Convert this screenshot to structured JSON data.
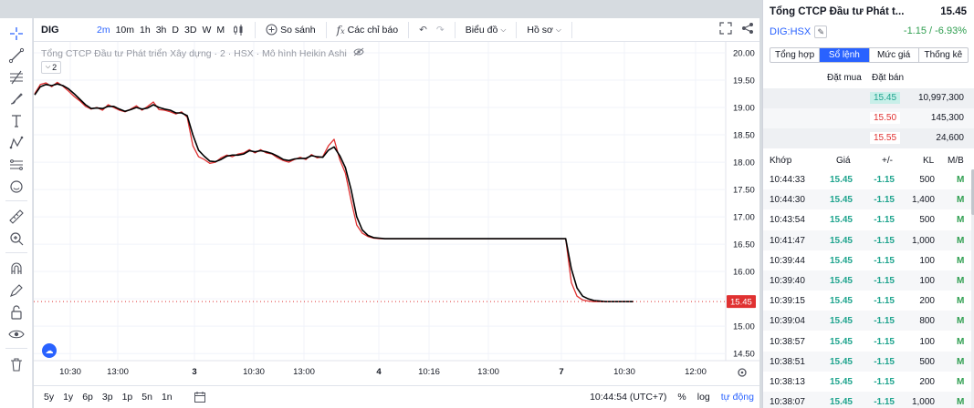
{
  "chart": {
    "symbol": "DIG",
    "intervals": [
      {
        "label": "2m",
        "active": true
      },
      {
        "label": "10m",
        "active": false
      },
      {
        "label": "1h",
        "active": false
      },
      {
        "label": "3h",
        "active": false
      },
      {
        "label": "D",
        "active": false
      },
      {
        "label": "3D",
        "active": false
      },
      {
        "label": "W",
        "active": false
      },
      {
        "label": "M",
        "active": false
      }
    ],
    "compare_label": "So sánh",
    "indicators_label": "Các chỉ báo",
    "chart_type_label": "Biểu đồ",
    "profile_label": "Hồ sơ",
    "legend_text": "Tổng CTCP Đầu tư Phát triển Xây dựng · 2 · HSX · Mô hình Heikin Ashi",
    "legend_toggle": "2",
    "time_ranges": [
      "5y",
      "1y",
      "6p",
      "3p",
      "1p",
      "5n",
      "1n"
    ],
    "clock": "10:44:54 (UTC+7)",
    "percent_label": "%",
    "log_label": "log",
    "auto_label": "tự động",
    "last_price_tag": "15.45",
    "accent": "#2962ff"
  },
  "chart_data": {
    "type": "line",
    "y_ticks": [
      "20.00",
      "19.50",
      "19.00",
      "18.50",
      "18.00",
      "17.50",
      "17.00",
      "16.50",
      "16.00",
      "15.50",
      "15.00",
      "14.50"
    ],
    "ylim": [
      14.5,
      20.0
    ],
    "x_ticks": [
      "10:30",
      "13:00",
      "3",
      "10:30",
      "13:00",
      "4",
      "10:16",
      "13:00",
      "7",
      "10:30",
      "12:00"
    ],
    "series": [
      {
        "color": "#000000",
        "values": [
          19.23,
          19.38,
          19.42,
          19.4,
          19.43,
          19.4,
          19.34,
          19.25,
          19.15,
          19.05,
          18.98,
          18.99,
          18.98,
          19.02,
          19.02,
          18.97,
          18.93,
          18.96,
          19.0,
          18.97,
          18.99,
          19.05,
          19.0,
          18.97,
          18.95,
          18.9,
          18.9,
          18.85,
          18.5,
          18.22,
          18.11,
          18.02,
          18.01,
          18.05,
          18.11,
          18.13,
          18.13,
          18.15,
          18.21,
          18.19,
          18.21,
          18.19,
          18.16,
          18.11,
          18.05,
          18.03,
          18.06,
          18.07,
          18.07,
          18.12,
          18.1,
          18.09,
          18.22,
          18.28,
          18.12,
          17.9,
          17.5,
          17.0,
          16.76,
          16.66,
          16.62,
          16.61,
          16.6,
          16.6,
          16.6,
          16.6,
          16.6,
          16.6,
          16.6,
          16.6,
          16.6,
          16.6,
          16.6,
          16.6,
          16.6,
          16.6,
          16.6,
          16.6,
          16.6,
          16.6,
          16.6,
          16.6,
          16.6,
          16.6,
          16.6,
          16.6,
          16.6,
          16.6,
          16.6,
          16.6,
          16.6,
          16.6,
          16.6,
          16.6,
          16.6,
          16.05,
          15.7,
          15.55,
          15.5,
          15.47,
          15.46,
          15.45,
          15.45,
          15.45,
          15.45,
          15.45,
          15.45
        ]
      },
      {
        "color": "#e03131",
        "values": [
          19.25,
          19.42,
          19.45,
          19.38,
          19.46,
          19.39,
          19.3,
          19.2,
          19.12,
          19.02,
          18.97,
          19.0,
          18.95,
          19.05,
          19.0,
          18.95,
          18.92,
          18.97,
          19.03,
          18.95,
          19.02,
          19.1,
          18.96,
          18.95,
          18.92,
          18.88,
          18.92,
          18.82,
          18.3,
          18.1,
          18.05,
          17.98,
          18.0,
          18.08,
          18.13,
          18.1,
          18.15,
          18.17,
          18.23,
          18.17,
          18.23,
          18.17,
          18.15,
          18.08,
          18.03,
          18.0,
          18.05,
          18.09,
          18.05,
          18.14,
          18.08,
          18.1,
          18.3,
          18.42,
          18.05,
          17.8,
          17.3,
          16.85,
          16.7,
          16.64,
          16.61,
          16.6,
          16.6,
          16.6,
          16.6,
          16.6,
          16.6,
          16.6,
          16.6,
          16.6,
          16.6,
          16.6,
          16.6,
          16.6,
          16.6,
          16.6,
          16.6,
          16.6,
          16.6,
          16.6,
          16.6,
          16.6,
          16.6,
          16.6,
          16.6,
          16.6,
          16.6,
          16.6,
          16.6,
          16.6,
          16.6,
          16.6,
          16.6,
          16.6,
          16.6,
          15.8,
          15.55,
          15.48,
          15.46,
          15.45,
          15.45,
          15.45,
          15.45,
          15.45,
          15.45,
          15.45,
          15.45
        ]
      }
    ],
    "last_price": 15.45,
    "grid": true
  },
  "panel": {
    "title": "Tổng CTCP Đầu tư Phát t...",
    "price": "15.45",
    "symbol": "DIG:HSX",
    "change": "-1.15 / -6.93%",
    "tabs": [
      {
        "label": "Tổng hợp",
        "active": false
      },
      {
        "label": "Sổ lệnh",
        "active": true
      },
      {
        "label": "Mức giá",
        "active": false
      },
      {
        "label": "Thống kê",
        "active": false
      }
    ],
    "orderbook_headers": {
      "bid": "Đặt mua",
      "ask": "Đặt bán"
    },
    "orderbook": [
      {
        "price": "15.45",
        "volume": "10,997,300",
        "side": "green"
      },
      {
        "price": "15.50",
        "volume": "145,300",
        "side": "red"
      },
      {
        "price": "15.55",
        "volume": "24,600",
        "side": "red"
      }
    ],
    "trade_headers": {
      "time": "Khớp",
      "price": "Giá",
      "change": "+/-",
      "volume": "KL",
      "side": "M/B"
    },
    "trades": [
      {
        "time": "10:44:33",
        "price": "15.45",
        "change": "-1.15",
        "volume": "500",
        "side": "M"
      },
      {
        "time": "10:44:30",
        "price": "15.45",
        "change": "-1.15",
        "volume": "1,400",
        "side": "M"
      },
      {
        "time": "10:43:54",
        "price": "15.45",
        "change": "-1.15",
        "volume": "500",
        "side": "M"
      },
      {
        "time": "10:41:47",
        "price": "15.45",
        "change": "-1.15",
        "volume": "1,000",
        "side": "M"
      },
      {
        "time": "10:39:44",
        "price": "15.45",
        "change": "-1.15",
        "volume": "100",
        "side": "M"
      },
      {
        "time": "10:39:40",
        "price": "15.45",
        "change": "-1.15",
        "volume": "100",
        "side": "M"
      },
      {
        "time": "10:39:15",
        "price": "15.45",
        "change": "-1.15",
        "volume": "200",
        "side": "M"
      },
      {
        "time": "10:39:04",
        "price": "15.45",
        "change": "-1.15",
        "volume": "800",
        "side": "M"
      },
      {
        "time": "10:38:57",
        "price": "15.45",
        "change": "-1.15",
        "volume": "100",
        "side": "M"
      },
      {
        "time": "10:38:51",
        "price": "15.45",
        "change": "-1.15",
        "volume": "500",
        "side": "M"
      },
      {
        "time": "10:38:13",
        "price": "15.45",
        "change": "-1.15",
        "volume": "200",
        "side": "M"
      },
      {
        "time": "10:38:07",
        "price": "15.45",
        "change": "-1.15",
        "volume": "1,000",
        "side": "M"
      }
    ]
  }
}
